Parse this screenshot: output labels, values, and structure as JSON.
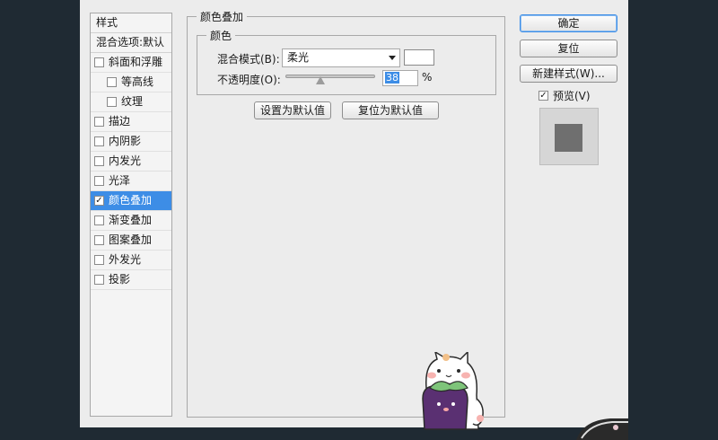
{
  "dialog": {
    "style_list": {
      "header": "样式",
      "blend_options": "混合选项:默认",
      "items": [
        {
          "label": "斜面和浮雕",
          "checked": false,
          "sub": false,
          "active": false
        },
        {
          "label": "等高线",
          "checked": false,
          "sub": true,
          "active": false
        },
        {
          "label": "纹理",
          "checked": false,
          "sub": true,
          "active": false
        },
        {
          "label": "描边",
          "checked": false,
          "sub": false,
          "active": false
        },
        {
          "label": "内阴影",
          "checked": false,
          "sub": false,
          "active": false
        },
        {
          "label": "内发光",
          "checked": false,
          "sub": false,
          "active": false
        },
        {
          "label": "光泽",
          "checked": false,
          "sub": false,
          "active": false
        },
        {
          "label": "颜色叠加",
          "checked": true,
          "sub": false,
          "active": true
        },
        {
          "label": "渐变叠加",
          "checked": false,
          "sub": false,
          "active": false
        },
        {
          "label": "图案叠加",
          "checked": false,
          "sub": false,
          "active": false
        },
        {
          "label": "外发光",
          "checked": false,
          "sub": false,
          "active": false
        },
        {
          "label": "投影",
          "checked": false,
          "sub": false,
          "active": false
        }
      ]
    },
    "panel": {
      "title": "颜色叠加",
      "color_group_title": "颜色",
      "blend_mode_label": "混合模式(B):",
      "blend_mode_value": "柔光",
      "opacity_label": "不透明度(O):",
      "opacity_value": "38",
      "opacity_fraction": 0.38,
      "percent_sign": "%",
      "swatch_color": "#ffffff",
      "set_default_button": "设置为默认值",
      "reset_default_button": "复位为默认值"
    },
    "right": {
      "ok_button": "确定",
      "reset_button": "复位",
      "new_style_button": "新建样式(W)...",
      "preview_label": "预览(V)",
      "preview_checked": true
    }
  },
  "colors": {
    "accent": "#3d8de6",
    "background": "#1f2a33",
    "dialog": "#ececec"
  }
}
